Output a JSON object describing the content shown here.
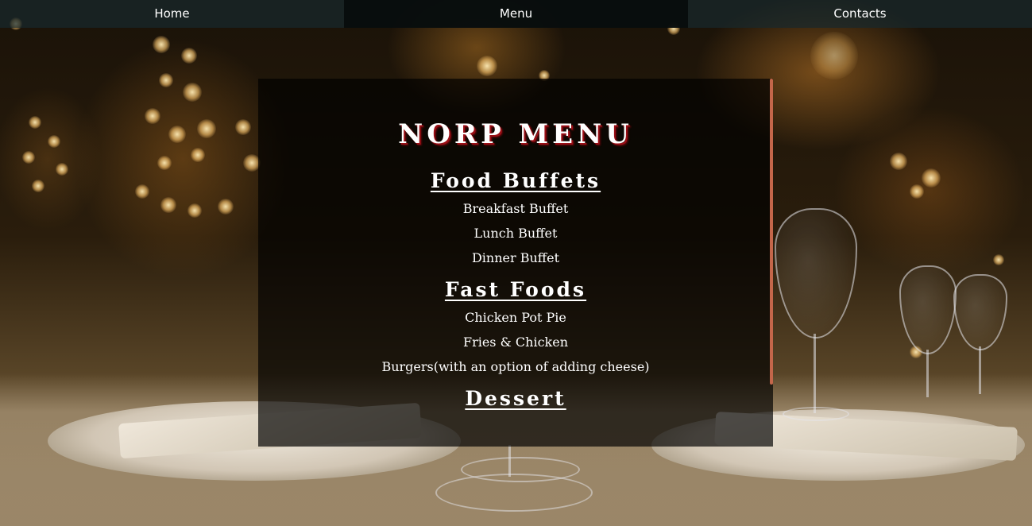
{
  "nav": {
    "items": [
      {
        "label": "Home",
        "active": false
      },
      {
        "label": "Menu",
        "active": true
      },
      {
        "label": "Contacts",
        "active": false
      }
    ]
  },
  "menu": {
    "title": "NORP MENU",
    "sections": [
      {
        "title": "Food Buffets",
        "items": [
          "Breakfast Buffet",
          "Lunch Buffet",
          "Dinner Buffet"
        ]
      },
      {
        "title": "Fast Foods",
        "items": [
          "Chicken Pot Pie",
          "Fries & Chicken",
          "Burgers(with an option of adding cheese)"
        ]
      },
      {
        "title": "Dessert",
        "items": []
      }
    ]
  },
  "colors": {
    "nav_bg": "#18282c",
    "nav_active_bg": "#080c0c",
    "panel_bg": "#000000",
    "title_shadow": "#9b0f16",
    "scrollbar": "#c4664a"
  }
}
